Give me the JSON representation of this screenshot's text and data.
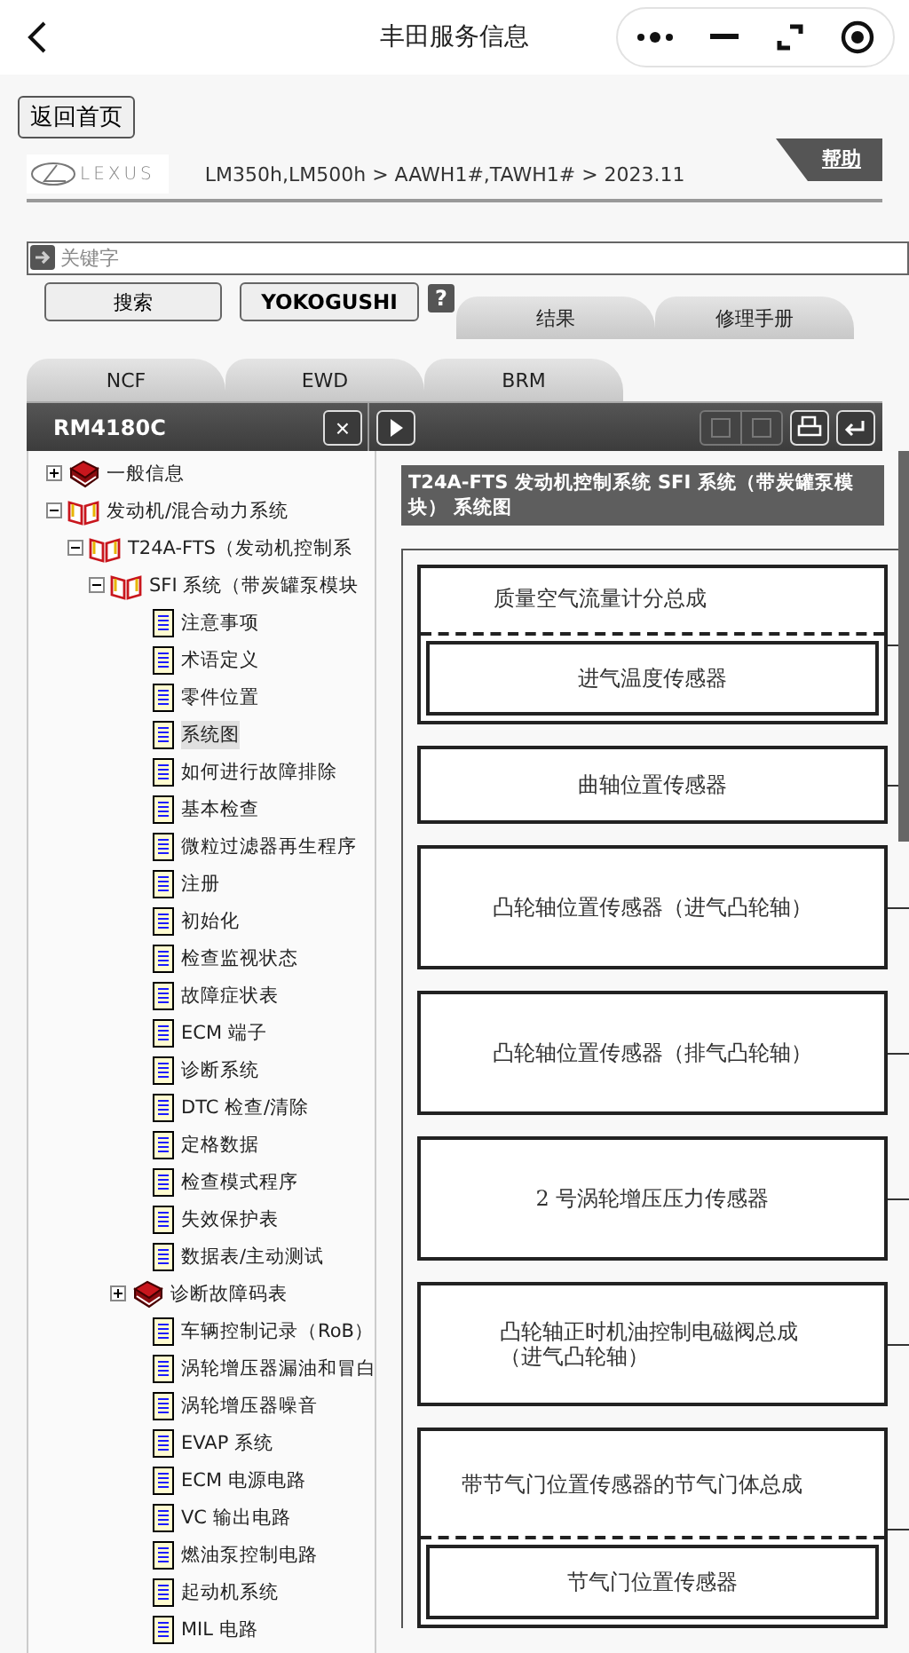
{
  "nav": {
    "title": "丰田服务信息"
  },
  "home_button": "返回首页",
  "brand": {
    "logo": "LEXUS",
    "breadcrumb": "LM350h,LM500h > AAWH1#,TAWH1# > 2023.11",
    "help": "帮助"
  },
  "search": {
    "placeholder": "关键字",
    "buttons": [
      "搜索",
      "YOKOGUSHI"
    ],
    "help_icon": "?"
  },
  "result_tabs": [
    {
      "label": "结果",
      "selected": false
    },
    {
      "label": "修理手册",
      "selected": false
    }
  ],
  "doc_tabs": [
    {
      "label": "NCF",
      "selected": false
    },
    {
      "label": "EWD",
      "selected": false
    },
    {
      "label": "BRM",
      "selected": false
    }
  ],
  "toolbar": {
    "title": "RM4180C",
    "close": "×"
  },
  "tree": [
    {
      "label": "一般信息",
      "kind": "folder",
      "expanded": false,
      "selected": false
    },
    {
      "label": "发动机/混合动力系统",
      "kind": "folder",
      "expanded": true,
      "selected": false,
      "children": [
        {
          "label": "T24A-FTS（发动机控制系",
          "kind": "folder",
          "expanded": true,
          "selected": false,
          "children": [
            {
              "label": "SFI 系统（带炭罐泵模块",
              "kind": "folder",
              "expanded": true,
              "selected": false,
              "children": [
                {
                  "label": "注意事项",
                  "kind": "page",
                  "selected": false
                },
                {
                  "label": "术语定义",
                  "kind": "page",
                  "selected": false
                },
                {
                  "label": "零件位置",
                  "kind": "page",
                  "selected": false
                },
                {
                  "label": "系统图",
                  "kind": "page",
                  "selected": true
                },
                {
                  "label": "如何进行故障排除",
                  "kind": "page",
                  "selected": false
                },
                {
                  "label": "基本检查",
                  "kind": "page",
                  "selected": false
                },
                {
                  "label": "微粒过滤器再生程序",
                  "kind": "page",
                  "selected": false
                },
                {
                  "label": "注册",
                  "kind": "page",
                  "selected": false
                },
                {
                  "label": "初始化",
                  "kind": "page",
                  "selected": false
                },
                {
                  "label": "检查监视状态",
                  "kind": "page",
                  "selected": false
                },
                {
                  "label": "故障症状表",
                  "kind": "page",
                  "selected": false
                },
                {
                  "label": "ECM 端子",
                  "kind": "page",
                  "selected": false
                },
                {
                  "label": "诊断系统",
                  "kind": "page",
                  "selected": false
                },
                {
                  "label": "DTC 检查/清除",
                  "kind": "page",
                  "selected": false
                },
                {
                  "label": "定格数据",
                  "kind": "page",
                  "selected": false
                },
                {
                  "label": "检查模式程序",
                  "kind": "page",
                  "selected": false
                },
                {
                  "label": "失效保护表",
                  "kind": "page",
                  "selected": false
                },
                {
                  "label": "数据表/主动测试",
                  "kind": "page",
                  "selected": false
                },
                {
                  "label": "诊断故障码表",
                  "kind": "folder",
                  "expanded": false,
                  "selected": false
                },
                {
                  "label": "车辆控制记录（RoB）",
                  "kind": "page",
                  "selected": false
                },
                {
                  "label": "涡轮增压器漏油和冒白",
                  "kind": "page",
                  "selected": false
                },
                {
                  "label": "涡轮增压器噪音",
                  "kind": "page",
                  "selected": false
                },
                {
                  "label": "EVAP 系统",
                  "kind": "page",
                  "selected": false
                },
                {
                  "label": "ECM 电源电路",
                  "kind": "page",
                  "selected": false
                },
                {
                  "label": "VC 输出电路",
                  "kind": "page",
                  "selected": false
                },
                {
                  "label": "燃油泵控制电路",
                  "kind": "page",
                  "selected": false
                },
                {
                  "label": "起动机系统",
                  "kind": "page",
                  "selected": false
                },
                {
                  "label": "MIL 电路",
                  "kind": "page",
                  "selected": false
                }
              ]
            }
          ]
        }
      ]
    }
  ],
  "diagram": {
    "heading": "T24A-FTS 发动机控制系统  SFI 系统（带炭罐泵模块） 系统图",
    "boxes": [
      {
        "kind": "group",
        "label": "质量空气流量计分总成",
        "sub": "进气温度传感器"
      },
      {
        "kind": "single",
        "label": "曲轴位置传感器"
      },
      {
        "kind": "single",
        "label": "凸轮轴位置传感器（进气凸轮轴）"
      },
      {
        "kind": "single",
        "label": "凸轮轴位置传感器（排气凸轮轴）"
      },
      {
        "kind": "single",
        "label": "2 号涡轮增压压力传感器"
      },
      {
        "kind": "single",
        "label": "凸轮轴正时机油控制电磁阀总成（进气凸轮轴）"
      },
      {
        "kind": "group",
        "label": "带节气门位置传感器的节气门体总成",
        "sub": "节气门位置传感器"
      }
    ]
  }
}
